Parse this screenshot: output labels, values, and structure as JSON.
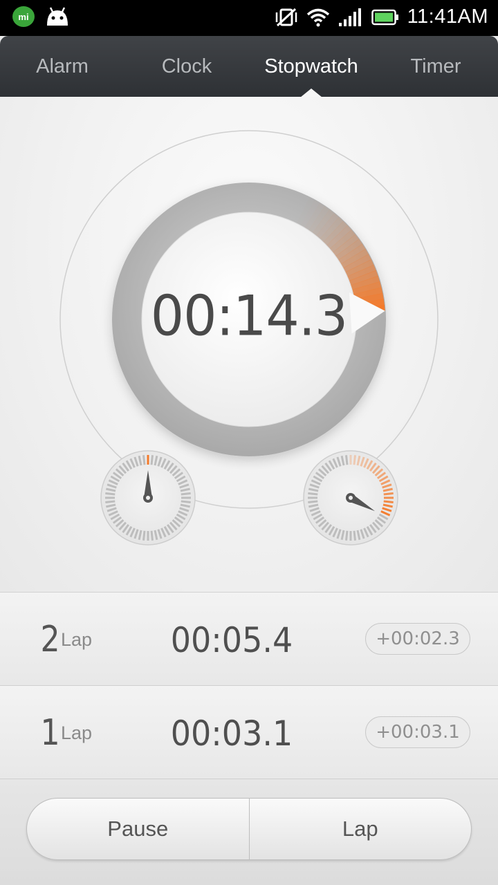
{
  "status_bar": {
    "time": "11:41AM",
    "icons": [
      "mi-talk-icon",
      "android-icon",
      "vibrate-off-icon",
      "wifi-icon",
      "signal-icon",
      "battery-icon"
    ],
    "mi_label": "mi"
  },
  "tabs": [
    {
      "label": "Alarm",
      "active": false
    },
    {
      "label": "Clock",
      "active": false
    },
    {
      "label": "Stopwatch",
      "active": true
    },
    {
      "label": "Timer",
      "active": false
    }
  ],
  "stopwatch": {
    "elapsed": "00:14.3",
    "accent_color": "#f47a2a",
    "progress_fraction": 0.24,
    "minute_subdial_fraction": 0.0,
    "second_subdial_fraction": 0.33
  },
  "laps": [
    {
      "number": "2",
      "label": "Lap",
      "time": "00:05.4",
      "diff": "+00:02.3"
    },
    {
      "number": "1",
      "label": "Lap",
      "time": "00:03.1",
      "diff": "+00:03.1"
    }
  ],
  "controls": {
    "pause_label": "Pause",
    "lap_label": "Lap"
  }
}
